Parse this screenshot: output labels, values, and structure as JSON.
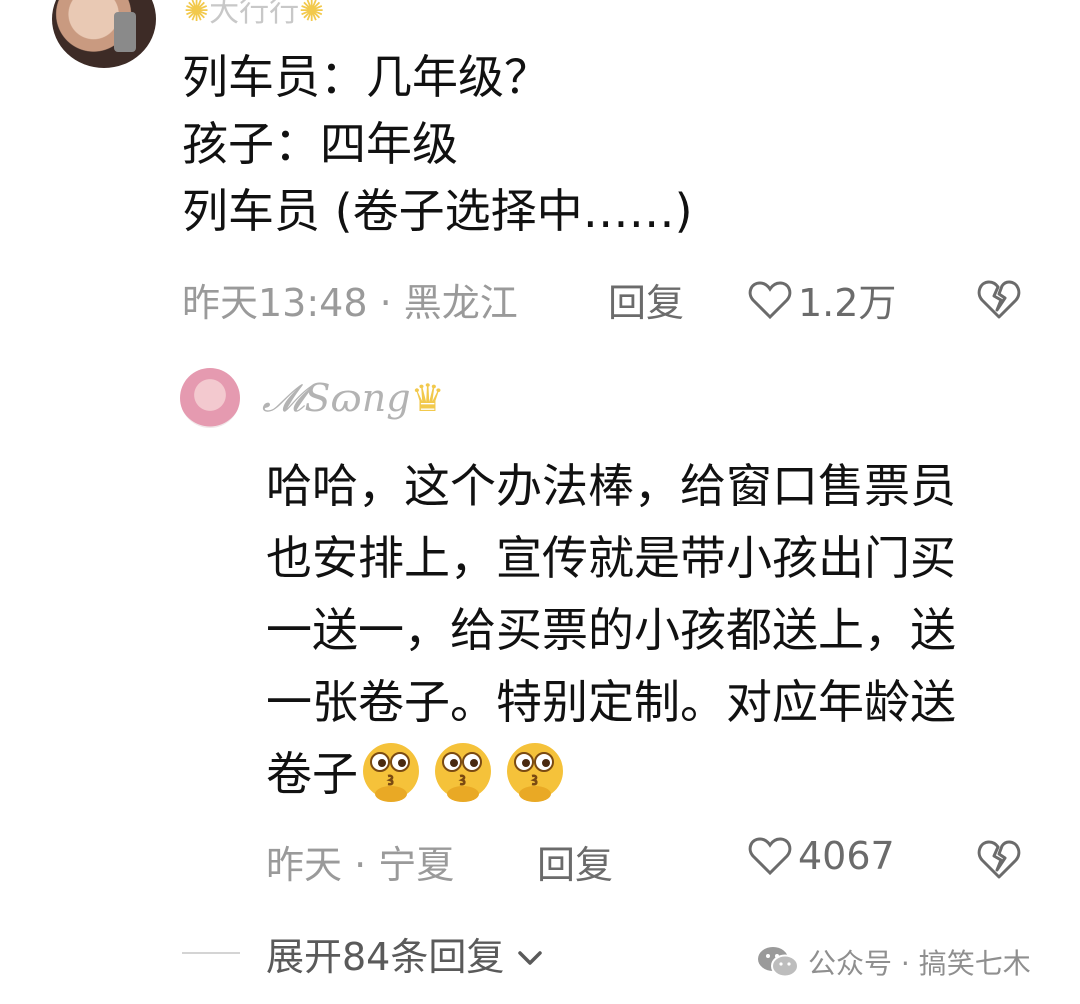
{
  "top_comment": {
    "username": "大行行",
    "lines": [
      "列车员：几年级？",
      "孩子：四年级",
      "列车员 (卷子选择中……)"
    ],
    "time": "昨天13:48",
    "separator": "·",
    "location": "黑龙江",
    "reply_label": "回复",
    "likes": "1.2万"
  },
  "reply_comment": {
    "username": "𝓜Sɷng",
    "lines": [
      "哈哈，这个办法棒，给窗口售票员",
      "也安排上，宣传就是带小孩出门买",
      "一送一，给买票的小孩都送上，送",
      "一张卷子。特别定制。对应年龄送",
      "卷子"
    ],
    "time": "昨天",
    "separator": "·",
    "location": "宁夏",
    "reply_label": "回复",
    "likes": "4067"
  },
  "expand_replies": "展开84条回复",
  "watermark": "公众号 · 搞笑七木",
  "icons": {
    "like": "heart-icon",
    "dislike": "broken-heart-icon",
    "expand": "chevron-down-icon",
    "watermark": "wechat-icon",
    "emoji": "thinking-face-emoji"
  },
  "colors": {
    "text": "#111111",
    "meta": "#9a9a9a",
    "emoji": "#f5c23a"
  }
}
